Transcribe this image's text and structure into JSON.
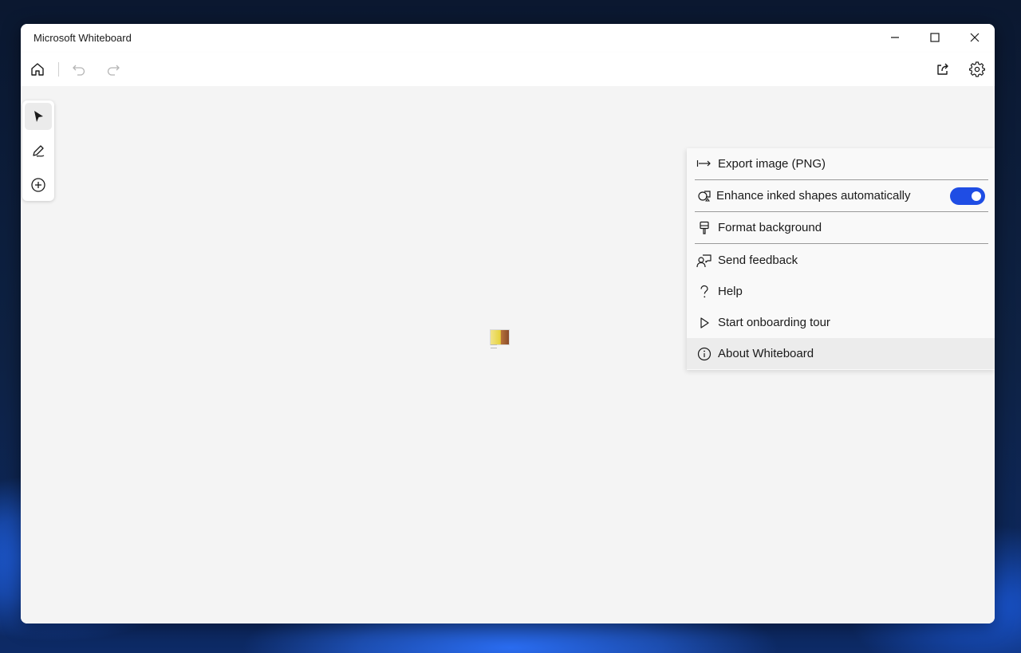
{
  "window": {
    "title": "Microsoft Whiteboard"
  },
  "toolbar": {
    "home_icon": "home-icon",
    "undo_icon": "undo-icon",
    "redo_icon": "redo-icon",
    "share_icon": "share-icon",
    "settings_icon": "gear-icon"
  },
  "tools": [
    {
      "name": "select",
      "icon": "pointer-icon",
      "active": true
    },
    {
      "name": "pen",
      "icon": "pen-icon",
      "active": false
    },
    {
      "name": "add",
      "icon": "add-circle-icon",
      "active": false
    }
  ],
  "settings_menu": {
    "items": [
      {
        "label": "Export image (PNG)",
        "icon": "export-arrow-icon"
      },
      {
        "label": "Enhance inked shapes automatically",
        "icon": "shapes-icon",
        "toggle": true,
        "toggle_on": true
      },
      {
        "label": "Format background",
        "icon": "paint-brush-icon"
      },
      {
        "label": "Send feedback",
        "icon": "feedback-icon"
      },
      {
        "label": "Help",
        "icon": "question-icon"
      },
      {
        "label": "Start onboarding tour",
        "icon": "play-icon"
      },
      {
        "label": "About Whiteboard",
        "icon": "info-icon",
        "highlighted": true
      }
    ]
  },
  "colors": {
    "accent": "#1f4de4",
    "canvas": "#f4f4f4"
  }
}
